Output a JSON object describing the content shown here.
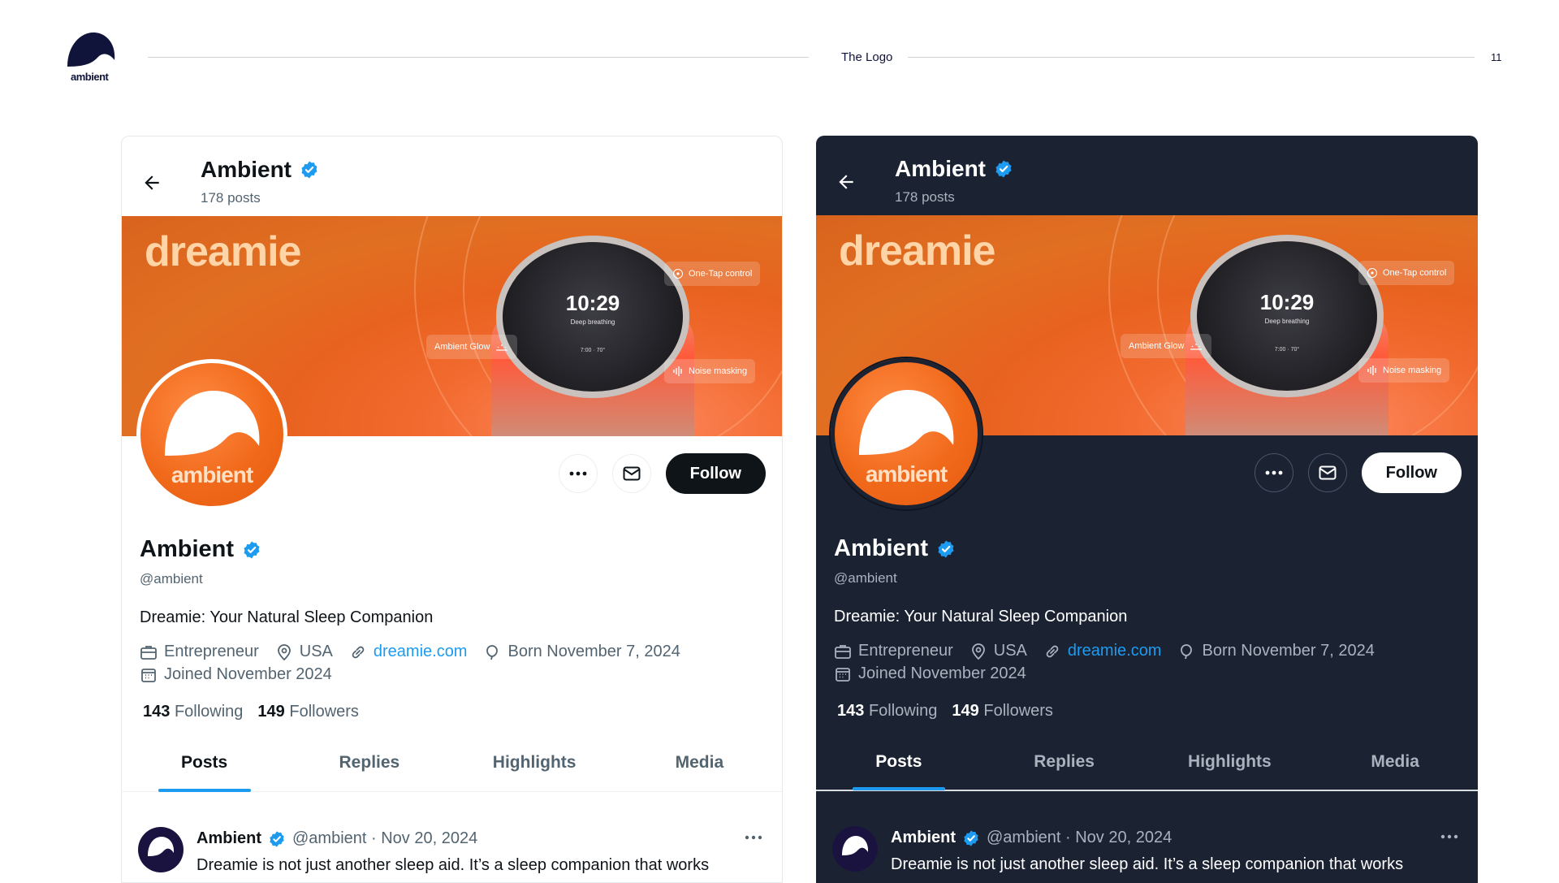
{
  "header": {
    "brand": "ambient",
    "title": "The Logo",
    "page_number": "11"
  },
  "profile": {
    "name": "Ambient",
    "posts_count": "178 posts",
    "banner_brand": "dreamie",
    "device_time": "10:29",
    "device_subtext": "Deep breathing",
    "device_subtext2": "7:00 · 70°",
    "chip_one_tap": "One-Tap control",
    "chip_glow": "Ambient Glow",
    "chip_noise": "Noise masking",
    "avatar_word": "ambient",
    "follow_label": "Follow",
    "handle": "@ambient",
    "bio": "Dreamie: Your Natural Sleep Companion",
    "occupation": "Entrepreneur",
    "location": "USA",
    "website": "dreamie.com",
    "born": "Born November 7, 2024",
    "joined": "Joined November 2024",
    "following_count": "143",
    "following_label": "Following",
    "followers_count": "149",
    "followers_label": "Followers"
  },
  "tabs": [
    {
      "label": "Posts",
      "active": true
    },
    {
      "label": "Replies",
      "active": false
    },
    {
      "label": "Highlights",
      "active": false
    },
    {
      "label": "Media",
      "active": false
    }
  ],
  "post": {
    "author": "Ambient",
    "meta": "@ambient · Nov 20, 2024",
    "text": "Dreamie is not just another sleep aid. It’s a sleep companion that works"
  },
  "colors": {
    "accent": "#1d9bf0",
    "dark_bg": "#1b2333",
    "brand_orange": "#f16a1b",
    "brand_navy": "#10133a"
  },
  "icons": [
    "back-arrow-icon",
    "verified-badge-icon",
    "more-icon",
    "mail-icon",
    "briefcase-icon",
    "location-pin-icon",
    "link-icon",
    "balloon-icon",
    "calendar-icon"
  ]
}
